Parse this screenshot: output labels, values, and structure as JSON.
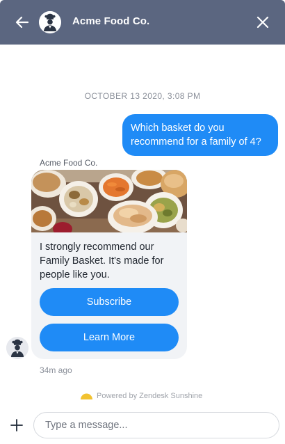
{
  "header": {
    "title": "Acme Food Co.",
    "back_icon": "arrow-left-icon",
    "avatar_icon": "chef-avatar-icon",
    "close_icon": "close-icon",
    "background_color": "#5b6680"
  },
  "conversation": {
    "date_separator": "OCTOBER 13 2020, 3:08 PM",
    "user_message": {
      "text": "Which basket do you recommend for a family of 4?",
      "color": "#1f8bf6"
    },
    "bot": {
      "sender_name": "Acme Food Co.",
      "card": {
        "image_icon": "food-basket-image",
        "text": "I strongly recommend our Family Basket. It's made for people like you.",
        "actions": [
          {
            "label": "Subscribe"
          },
          {
            "label": "Learn More"
          }
        ]
      },
      "avatar_icon": "chef-avatar-icon",
      "timestamp": "34m ago"
    }
  },
  "footer": {
    "powered_by": "Powered by Zendesk Sunshine",
    "powered_icon": "sunshine-logo-icon"
  },
  "composer": {
    "plus_icon": "plus-icon",
    "placeholder": "Type a message..."
  }
}
